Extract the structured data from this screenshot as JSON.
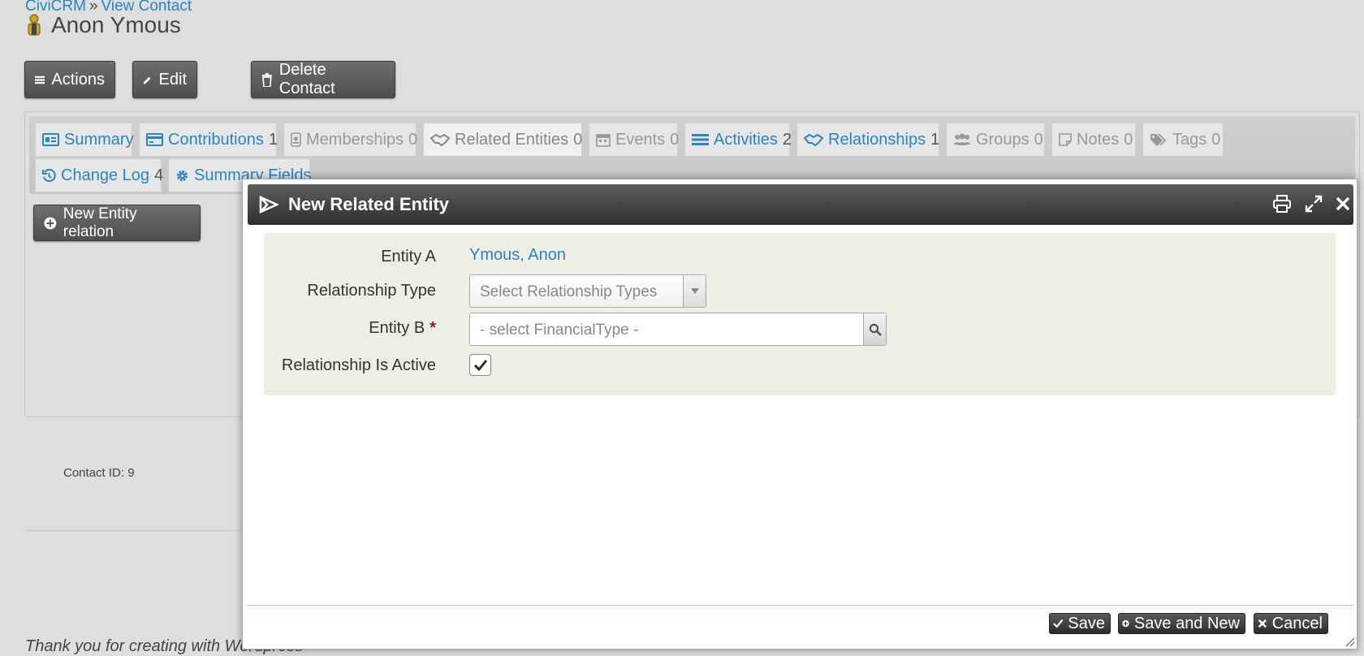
{
  "breadcrumb": {
    "home": "CiviCRM",
    "separator": "»",
    "current": "View Contact"
  },
  "contact": {
    "name": "Anon Ymous",
    "id_label": "Contact ID: 9"
  },
  "actions": {
    "actions_label": "Actions",
    "edit_label": "Edit",
    "delete_label": "Delete Contact"
  },
  "tabs": [
    {
      "label": "Summary",
      "count": "",
      "icon": "address-card-icon"
    },
    {
      "label": "Contributions",
      "count": "1",
      "icon": "credit-card-icon"
    },
    {
      "label": "Memberships",
      "count": "0",
      "icon": "id-badge-icon"
    },
    {
      "label": "Related Entities",
      "count": "0",
      "icon": "handshake-icon"
    },
    {
      "label": "Events",
      "count": "0",
      "icon": "calendar-icon"
    },
    {
      "label": "Activities",
      "count": "2",
      "icon": "tasks-icon"
    },
    {
      "label": "Relationships",
      "count": "1",
      "icon": "handshake-icon"
    },
    {
      "label": "Groups",
      "count": "0",
      "icon": "users-icon"
    },
    {
      "label": "Notes",
      "count": "0",
      "icon": "sticky-note-icon"
    },
    {
      "label": "Tags",
      "count": "0",
      "icon": "tags-icon"
    },
    {
      "label": "Change Log",
      "count": "4",
      "icon": "history-icon"
    },
    {
      "label": "Summary Fields",
      "count": "",
      "icon": "gear-icon"
    }
  ],
  "new_entity_button": "New Entity relation",
  "dialog": {
    "title": "New Related Entity",
    "fields": {
      "entity_a_label": "Entity A",
      "entity_a_value": "Ymous, Anon",
      "relationship_type_label": "Relationship Type",
      "relationship_type_placeholder": "Select Relationship Types",
      "entity_b_label": "Entity B",
      "entity_b_required": "*",
      "entity_b_placeholder": "- select FinancialType -",
      "active_label": "Relationship Is Active",
      "active_checked": true
    },
    "buttons": {
      "save": "Save",
      "save_new": "Save and New",
      "cancel": "Cancel"
    }
  },
  "footer": {
    "text": "Thank you for creating with Wordpress"
  },
  "colors": {
    "link": "#2786c2",
    "button_dark": "#4f4f4f",
    "form_bg": "#eeeee5",
    "required": "#8a1f11"
  }
}
